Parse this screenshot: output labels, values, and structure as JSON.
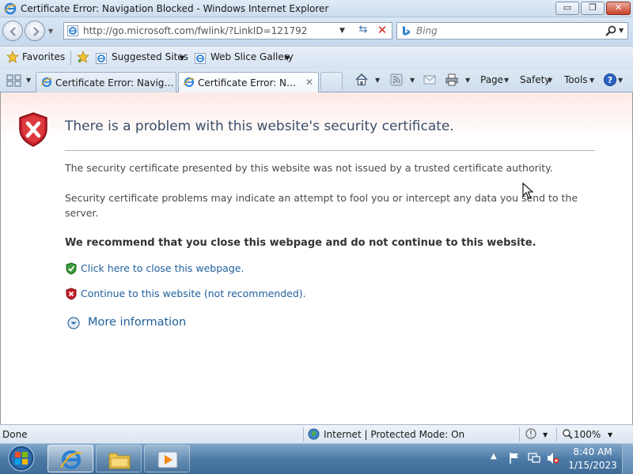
{
  "window": {
    "title": "Certificate Error: Navigation Blocked - Windows Internet Explorer",
    "minimize_label": "▭",
    "maximize_label": "❐",
    "close_label": "✕"
  },
  "address_bar": {
    "url": "http://go.microsoft.com/fwlink/?LinkID=121792"
  },
  "search": {
    "placeholder": "Bing"
  },
  "favorites_bar": {
    "favorites_label": "Favorites",
    "items": [
      {
        "label": "Suggested Sites"
      },
      {
        "label": "Web Slice Gallery"
      }
    ]
  },
  "tabs": [
    {
      "label": "Certificate Error: Navigatio...",
      "active": false
    },
    {
      "label": "Certificate Error: Navig...",
      "active": true
    }
  ],
  "command_bar": {
    "page_label": "Page",
    "safety_label": "Safety",
    "tools_label": "Tools"
  },
  "page": {
    "headline": "There is a problem with this website's security certificate.",
    "paragraph_1": "The security certificate presented by this website was not issued by a trusted certificate authority.",
    "paragraph_2": "Security certificate problems may indicate an attempt to fool you or intercept any data you send to the server.",
    "recommendation": "We recommend that you close this webpage and do not continue to this website.",
    "close_link": "Click here to close this webpage.",
    "continue_link": "Continue to this website (not recommended).",
    "more_info": "More information"
  },
  "status_bar": {
    "status": "Done",
    "zone": "Internet | Protected Mode: On",
    "zoom": "100%"
  },
  "taskbar": {
    "time": "8:40 AM",
    "date": "1/15/2023"
  },
  "colors": {
    "link": "#1f5f9c",
    "headline": "#3b4e6a",
    "shield_red": "#c8202a",
    "shield_green": "#3b9a3a"
  }
}
